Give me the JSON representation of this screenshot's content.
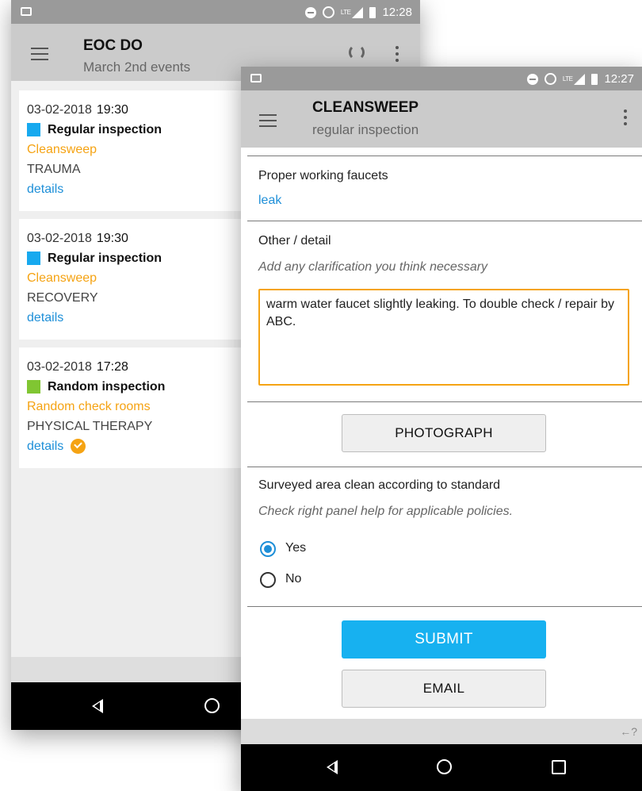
{
  "back_phone": {
    "status_time": "12:28",
    "title": "EOC DO",
    "subtitle": "March 2nd events",
    "events": [
      {
        "date": "03-02-2018",
        "time": "19:30",
        "type": "Regular inspection",
        "type_color": "#17a9ef",
        "team": "Cleansweep",
        "area": "TRAUMA",
        "details": "details",
        "completed": false
      },
      {
        "date": "03-02-2018",
        "time": "19:30",
        "type": "Regular inspection",
        "type_color": "#17a9ef",
        "team": "Cleansweep",
        "area": "RECOVERY",
        "details": "details",
        "completed": false
      },
      {
        "date": "03-02-2018",
        "time": "17:28",
        "type": "Random inspection",
        "type_color": "#80c632",
        "team": "Random check rooms",
        "area": "PHYSICAL THERAPY",
        "details": "details",
        "completed": true
      }
    ]
  },
  "front_phone": {
    "status_time": "12:27",
    "title": "CLEANSWEEP",
    "subtitle": "regular inspection",
    "faucets": {
      "label": "Proper working faucets",
      "value": "leak"
    },
    "other": {
      "label": "Other / detail",
      "hint": "Add any clarification you think necessary",
      "text": "warm water faucet slightly leaking. To double check / repair by ABC."
    },
    "photograph_label": "PHOTOGRAPH",
    "surveyed": {
      "label": "Surveyed area clean according to standard",
      "hint": "Check right panel help for applicable policies.",
      "options": [
        "Yes",
        "No"
      ],
      "selected": "Yes"
    },
    "submit_label": "SUBMIT",
    "email_label": "EMAIL",
    "help_glyph": "←?"
  },
  "colors": {
    "accent_orange": "#f5a313",
    "link_blue": "#1e8fd8",
    "submit_blue": "#17b1f0",
    "appbar_grey": "#cbcbcb"
  }
}
